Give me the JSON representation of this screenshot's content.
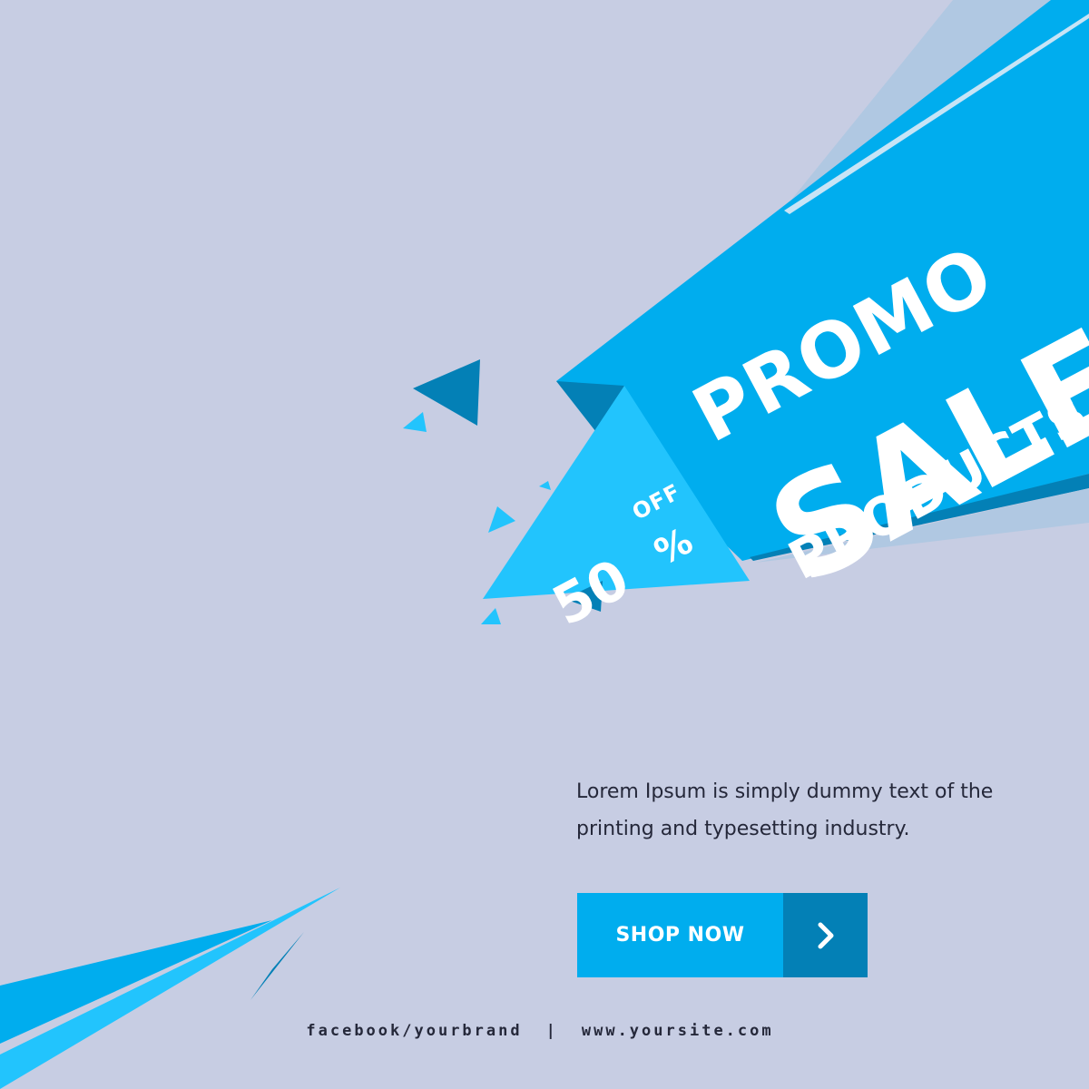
{
  "headline": {
    "line1": "PROMO",
    "line2": "SALE",
    "line3": "PRODUCTS"
  },
  "discount": {
    "value": "50",
    "off_label": "OFF",
    "percent_sign": "%"
  },
  "description": "Lorem Ipsum is simply dummy text of the printing and typesetting industry.",
  "cta": {
    "label": "SHOP NOW",
    "icon": "chevron-right-icon"
  },
  "footer": {
    "facebook": "facebook/yourbrand",
    "separator": "|",
    "website": "www.yoursite.com"
  },
  "colors": {
    "background": "#c7cde3",
    "primary_blue": "#00adee",
    "light_blue": "#22c4fd",
    "dark_blue": "#0380b6",
    "pale_blue": "#b0c8e2",
    "text_dark": "#25283a",
    "white": "#ffffff"
  }
}
